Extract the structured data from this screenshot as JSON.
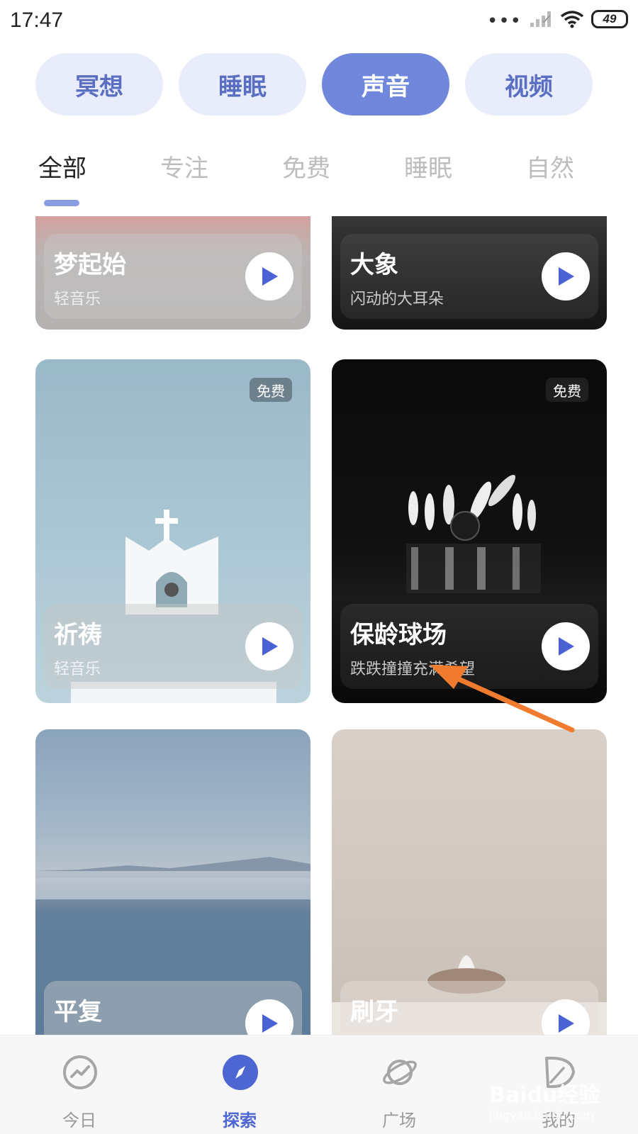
{
  "status_bar": {
    "time": "17:47",
    "battery": "49",
    "icons": [
      "more-dots-icon",
      "cellular-signal-icon",
      "wifi-icon",
      "battery-icon"
    ]
  },
  "categories": [
    {
      "label": "冥想",
      "active": false
    },
    {
      "label": "睡眠",
      "active": false
    },
    {
      "label": "声音",
      "active": true
    },
    {
      "label": "视频",
      "active": false
    }
  ],
  "sub_tabs": [
    {
      "label": "全部",
      "active": true
    },
    {
      "label": "专注",
      "active": false
    },
    {
      "label": "免费",
      "active": false
    },
    {
      "label": "睡眠",
      "active": false
    },
    {
      "label": "自然",
      "active": false
    }
  ],
  "cards": [
    {
      "title": "梦起始",
      "subtitle": "轻音乐",
      "badge": ""
    },
    {
      "title": "大象",
      "subtitle": "闪动的大耳朵",
      "badge": ""
    },
    {
      "title": "祈祷",
      "subtitle": "轻音乐",
      "badge": "免费"
    },
    {
      "title": "保龄球场",
      "subtitle": "跌跌撞撞充满希望",
      "badge": "免费"
    },
    {
      "title": "平复",
      "subtitle": "",
      "badge": ""
    },
    {
      "title": "刷牙",
      "subtitle": "",
      "badge": ""
    }
  ],
  "bottom_nav": [
    {
      "label": "今日",
      "icon": "trend-icon",
      "active": false
    },
    {
      "label": "探索",
      "icon": "compass-icon",
      "active": true
    },
    {
      "label": "广场",
      "icon": "planet-icon",
      "active": false
    },
    {
      "label": "我的",
      "icon": "leaf-icon",
      "active": false
    }
  ],
  "watermark": {
    "brand": "Baidu经验",
    "url": "jingyan.baidu.com"
  },
  "colors": {
    "accent": "#7087dc",
    "pill_bg": "#e9ecfa",
    "nav_active": "#4e66d1",
    "annotation_arrow": "#f07a2e"
  }
}
